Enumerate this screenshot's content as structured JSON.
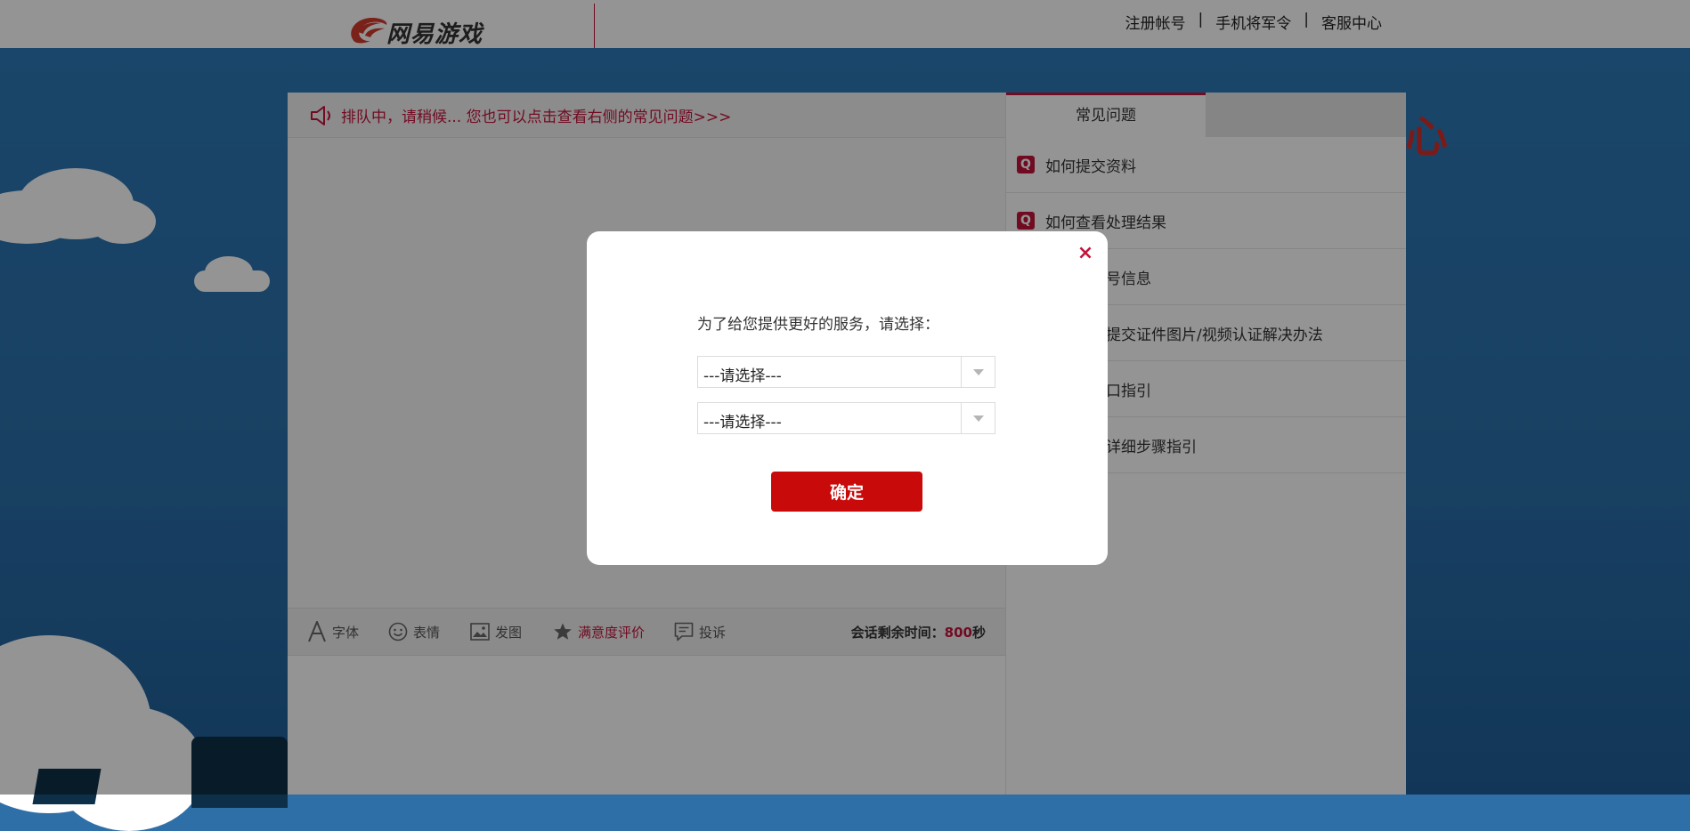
{
  "header": {
    "logo_text": "网易游戏",
    "links": [
      {
        "label": "注册帐号"
      },
      {
        "label": "手机将军令"
      },
      {
        "label": "客服中心"
      }
    ],
    "separator": "|"
  },
  "chat": {
    "notice": "排队中，请稍候... 您也可以点击查看右侧的常见问题>>>",
    "toolbar": {
      "font": "字体",
      "emoji": "表情",
      "image": "发图",
      "rating": "满意度评价",
      "complaint": "投诉"
    },
    "timer": {
      "label": "会话剩余时间：",
      "value": "800",
      "unit": "秒"
    }
  },
  "faq": {
    "tab_label": "常见问题",
    "badge": "Q",
    "items": [
      {
        "label": "如何提交资料"
      },
      {
        "label": "如何查看处理结果"
      },
      {
        "label": "何修改帐号信息"
      },
      {
        "label": "无法正常提交证件图片/视频认证解决办法"
      },
      {
        "label": "大神端入口指引"
      },
      {
        "label": "帐号修复详细步骤指引"
      }
    ]
  },
  "modal": {
    "prompt": "为了给您提供更好的服务，请选择：",
    "select_1": "---请选择---",
    "select_2": "---请选择---",
    "confirm_label": "确定",
    "close_glyph": "×"
  },
  "background": {
    "hero_char": "心"
  },
  "colors": {
    "accent": "#c3143c",
    "button": "#c80a0a",
    "sky": "#2c79b7"
  }
}
